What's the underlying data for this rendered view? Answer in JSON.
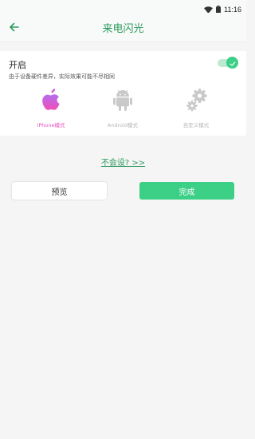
{
  "status_bar": {
    "time": "11:16"
  },
  "app_bar": {
    "title": "来电闪光"
  },
  "toggle": {
    "title": "开启",
    "description": "由于设备硬件差异，实际效果可能不尽相同",
    "enabled": true
  },
  "modes": [
    {
      "label": "iPhone模式",
      "icon": "apple-icon",
      "selected": true
    },
    {
      "label": "Android模式",
      "icon": "android-icon",
      "selected": false
    },
    {
      "label": "自定义模式",
      "icon": "gears-icon",
      "selected": false
    }
  ],
  "help_link": "不会设? >>",
  "buttons": {
    "preview": "预览",
    "done": "完成"
  },
  "colors": {
    "accent": "#3ccf86",
    "title": "#2e9a5d",
    "selected_mode": "#e64fbf",
    "inactive_icon": "#c9c9c9"
  }
}
